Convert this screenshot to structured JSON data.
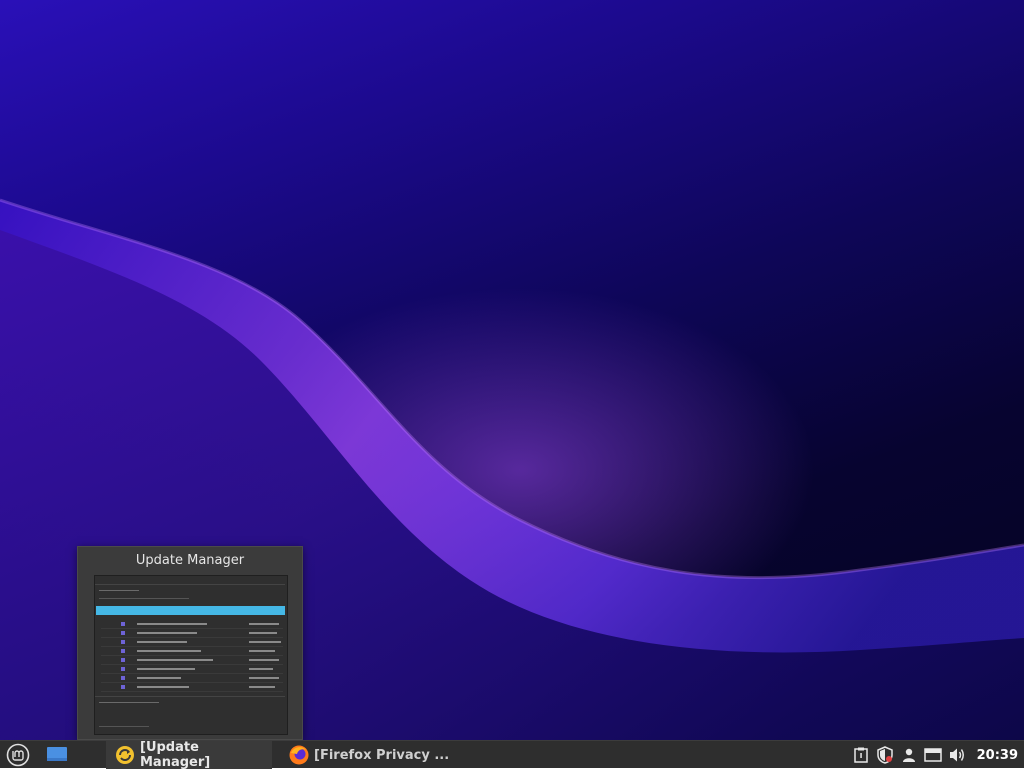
{
  "preview": {
    "title": "Update Manager"
  },
  "taskbar": {
    "windows": [
      {
        "label": "[Update Manager]",
        "icon": "update-manager-icon"
      },
      {
        "label": "[Firefox Privacy ...",
        "icon": "firefox-icon"
      }
    ],
    "tray_icons": [
      "notes-icon",
      "shield-icon",
      "user-icon",
      "network-icon",
      "volume-icon"
    ],
    "clock": "20:39"
  },
  "colors": {
    "accent": "#45b8e6",
    "taskbar": "#2e2e2e",
    "wallpaper_deep": "#05031f",
    "wallpaper_violet": "#2a10b8"
  }
}
